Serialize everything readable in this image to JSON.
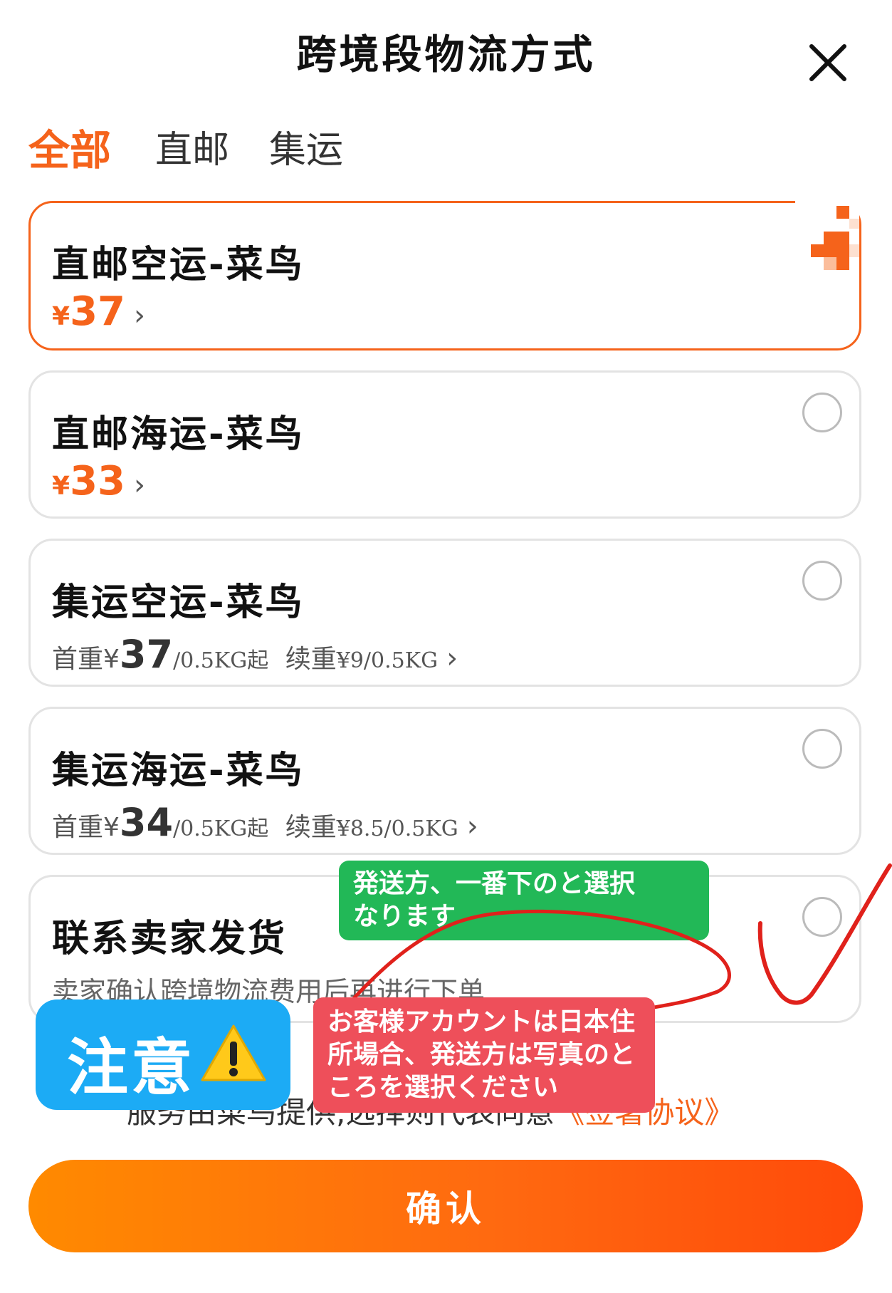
{
  "header": {
    "title": "跨境段物流方式",
    "close_icon": "close-icon"
  },
  "tabs": [
    {
      "label": "全部",
      "active": true
    },
    {
      "label": "直邮",
      "active": false
    },
    {
      "label": "集运",
      "active": false
    }
  ],
  "options": [
    {
      "title": "直邮空运-菜鸟",
      "yen": "¥",
      "price": "37",
      "selected": true
    },
    {
      "title": "直邮海运-菜鸟",
      "yen": "¥",
      "price": "33",
      "selected": false
    },
    {
      "title": "集运空运-菜鸟",
      "first_label": "首重",
      "yen": "¥",
      "first_price": "37",
      "first_unit": "/0.5KG起",
      "cont_label": "续重",
      "cont_price": "¥9/0.5KG",
      "selected": false
    },
    {
      "title": "集运海运-菜鸟",
      "first_label": "首重",
      "yen": "¥",
      "first_price": "34",
      "first_unit": "/0.5KG起",
      "cont_label": "续重",
      "cont_price": "¥8.5/0.5KG",
      "selected": false
    },
    {
      "title": "联系卖家发货",
      "subtitle": "卖家确认跨境物流费用后再进行下单",
      "selected": false
    }
  ],
  "footer": {
    "agreement_text": "服务由菜鸟提供,选择则代表同意",
    "agreement_link": "《签署协议》",
    "confirm_label": "确认"
  },
  "annotations": {
    "green_line1": "発送方、一番下のと選択",
    "green_line2": "なります",
    "red_text": "お客様アカウントは日本住所場合、発送方は写真のところを選択ください",
    "blue_text": "注意"
  },
  "colors": {
    "accent": "#f5631b",
    "green_note": "#22b857",
    "red_note": "#ee4f5a",
    "blue_note": "#1cabf5",
    "scribble": "#e0211b"
  }
}
